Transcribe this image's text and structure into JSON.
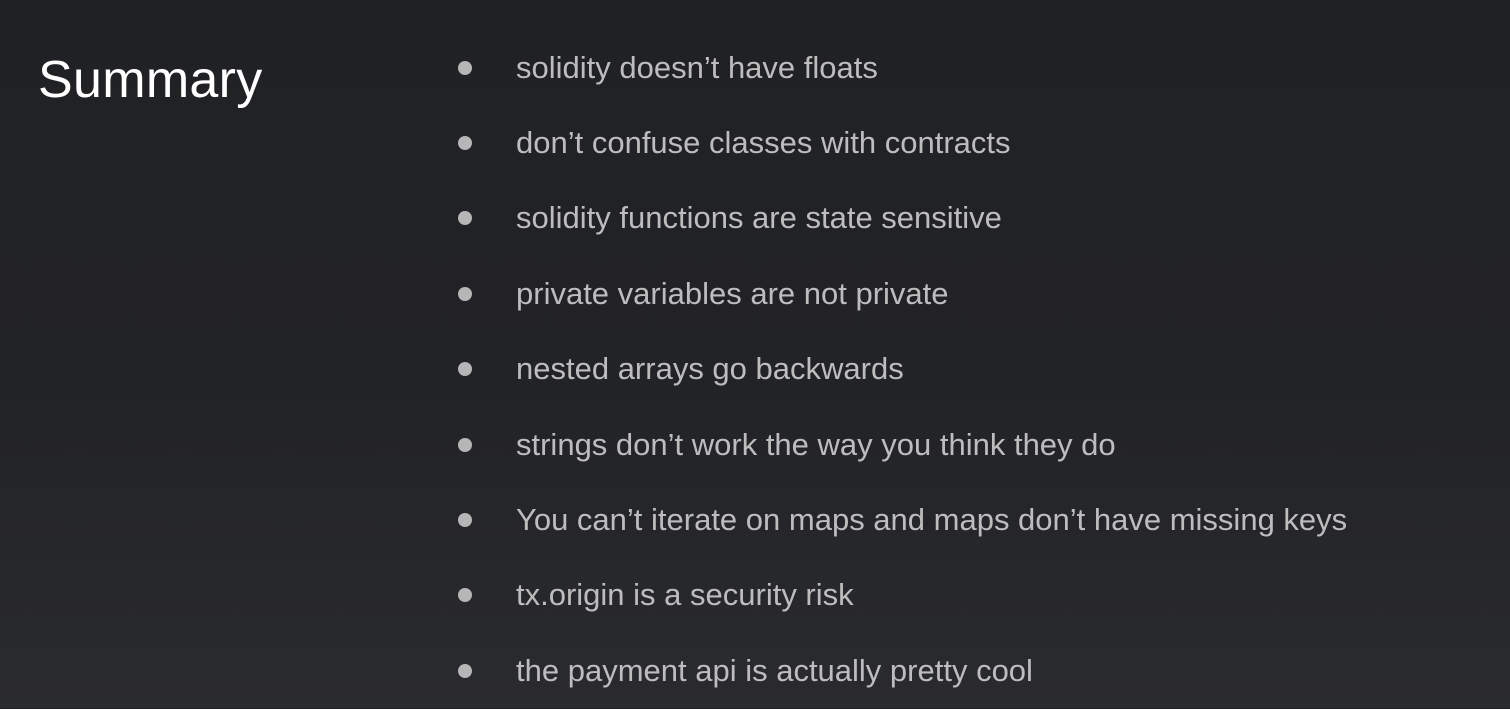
{
  "slide": {
    "title": "Summary",
    "bullets": [
      "solidity doesn’t have floats",
      "don’t confuse classes with contracts",
      "solidity functions are state sensitive",
      "private variables are not private",
      "nested arrays go backwards",
      "strings don’t work the way you think they do",
      "You can’t iterate on maps and maps don’t have missing keys",
      "tx.origin is a security risk",
      "the payment api is actually pretty cool"
    ]
  },
  "colors": {
    "background": "#222326",
    "title": "#ffffff",
    "bullet_text": "#bdbdbd",
    "bullet_dot": "#b6b6b6"
  },
  "icons": {
    "bullet": "filled-circle"
  }
}
